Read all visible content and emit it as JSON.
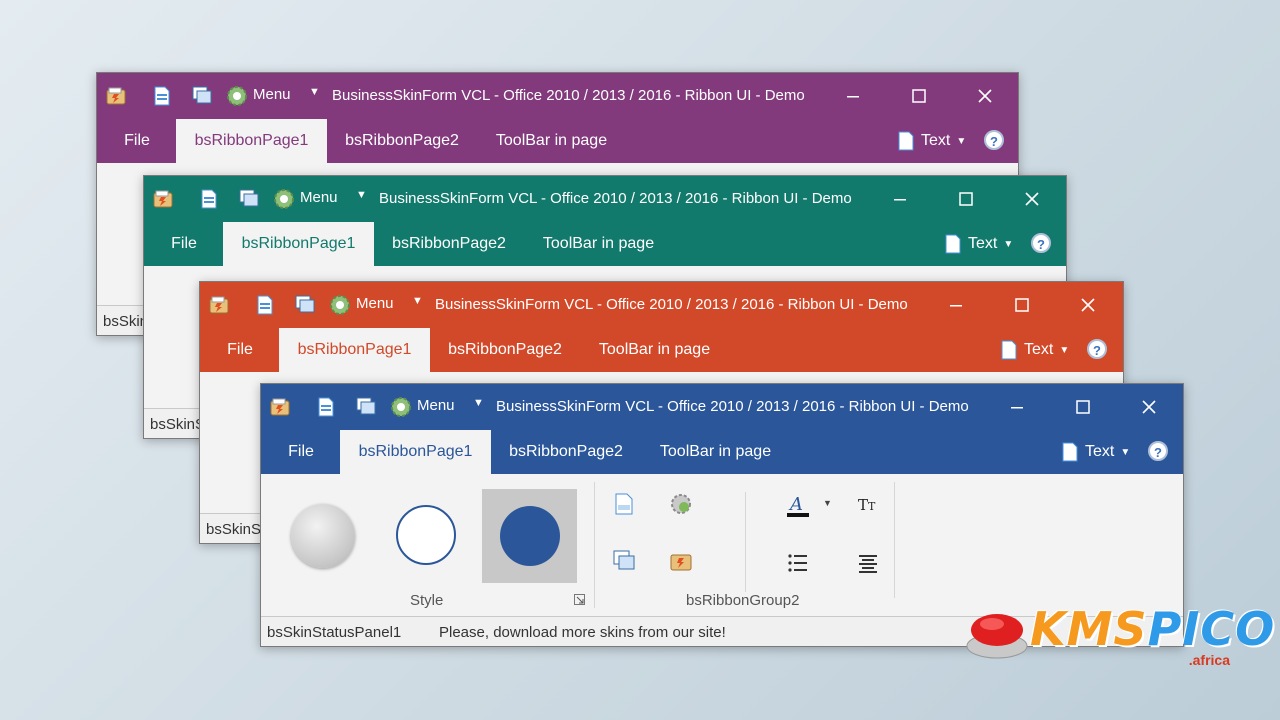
{
  "colors": {
    "purple": "#833a7d",
    "teal": "#127a6c",
    "orange": "#d2492a",
    "blue": "#2b579a"
  },
  "window": {
    "title": "BusinessSkinForm VCL - Office 2010 / 2013 / 2016 - Ribbon UI - Demo",
    "menu_label": "Menu",
    "tabs": {
      "file": "File",
      "page1": "bsRibbonPage1",
      "page2": "bsRibbonPage2",
      "toolbar": "ToolBar in page"
    },
    "text_button": "Text",
    "help_glyph": "?",
    "status_panel_short": "bsSkin",
    "status_panel_short2": "bsSkinS",
    "status_panel_short3": "bsSkinSt"
  },
  "ribbon": {
    "group1_label": "Style",
    "group2_label": "bsRibbonGroup2"
  },
  "status": {
    "panel": "bsSkinStatusPanel1",
    "message": "Please, download more skins from our site!"
  },
  "logo": {
    "main_k": "KMS",
    "main_p": "PICO",
    "sub": ".africa"
  },
  "icons": [
    "app-icon",
    "new-document-icon",
    "copy-windows-icon",
    "gear-icon",
    "caret-down-icon",
    "minimize-icon",
    "maximize-icon",
    "close-icon",
    "document-icon",
    "help-icon",
    "font-color-icon",
    "font-size-icon",
    "bullet-list-icon",
    "align-center-icon",
    "dialog-launcher-icon"
  ]
}
